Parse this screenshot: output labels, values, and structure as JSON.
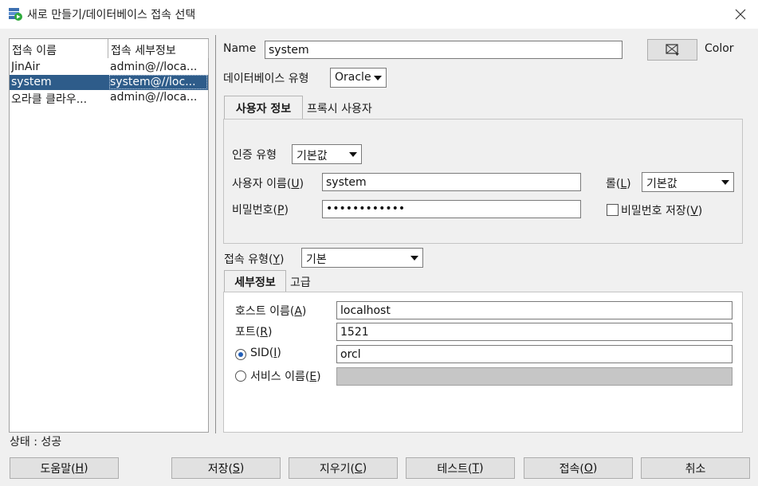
{
  "window": {
    "title": "새로 만들기/데이터베이스 접속 선택",
    "accent_color": "#2e5c8a"
  },
  "connections": {
    "columns": [
      "접속 이름",
      "접속 세부정보"
    ],
    "rows": [
      {
        "name": "JinAir",
        "detail": "admin@//loca..."
      },
      {
        "name": "system",
        "detail": "system@//loc...",
        "selected": true
      },
      {
        "name": "오라클 클라우...",
        "detail": "admin@//loca..."
      }
    ]
  },
  "form": {
    "name_label": "Name",
    "name_value": "system",
    "color_label": "Color",
    "db_type_label": "데이터베이스 유형",
    "db_type_value": "Oracle",
    "tabs_top": {
      "active": "사용자 정보",
      "other": "프록시 사용자"
    },
    "auth_type_label": "인증 유형",
    "auth_type_value": "기본값",
    "username_label_pre": "사용자 이름(",
    "username_mnemonic": "U",
    "username_label_post": ")",
    "username_value": "system",
    "role_label_pre": "롤(",
    "role_mnemonic": "L",
    "role_label_post": ")",
    "role_value": "기본값",
    "password_label_pre": "비밀번호(",
    "password_mnemonic": "P",
    "password_label_post": ")",
    "password_value": "••••••••••••",
    "save_password_pre": "비밀번호 저장(",
    "save_password_mnemonic": "V",
    "save_password_post": ")",
    "save_password_checked": false,
    "conn_type_label_pre": "접속 유형(",
    "conn_type_mnemonic": "Y",
    "conn_type_label_post": ")",
    "conn_type_value": "기본",
    "tabs_bottom": {
      "active": "세부정보",
      "other": "고급"
    },
    "host_label_pre": "호스트 이름(",
    "host_mnemonic": "A",
    "host_label_post": ")",
    "host_value": "localhost",
    "port_label_pre": "포트(",
    "port_mnemonic": "R",
    "port_label_post": ")",
    "port_value": "1521",
    "sid_label_pre": "SID(",
    "sid_mnemonic": "I",
    "sid_label_post": ")",
    "sid_value": "orcl",
    "sid_selected": true,
    "service_label_pre": "서비스 이름(",
    "service_mnemonic": "E",
    "service_label_post": ")",
    "service_value": ""
  },
  "status": {
    "text": "상태 : 성공"
  },
  "buttons": {
    "help": {
      "pre": "도움말(",
      "m": "H",
      "post": ")"
    },
    "save": {
      "pre": "저장(",
      "m": "S",
      "post": ")"
    },
    "clear": {
      "pre": "지우기(",
      "m": "C",
      "post": ")"
    },
    "test": {
      "pre": "테스트(",
      "m": "T",
      "post": ")"
    },
    "connect": {
      "pre": "접속(",
      "m": "O",
      "post": ")"
    },
    "cancel": {
      "label": "취소"
    }
  }
}
